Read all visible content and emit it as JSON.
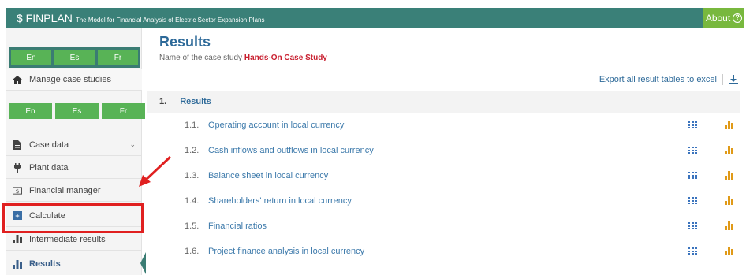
{
  "header": {
    "app_name": "$ FINPLAN",
    "tagline": "The Model for Financial Analysis of Electric Sector Expansion Plans",
    "about_label": "About",
    "about_icon": "?"
  },
  "sidebar": {
    "languages_top": [
      "En",
      "Es",
      "Fr"
    ],
    "manage_label": "Manage case studies",
    "languages_mid": [
      "En",
      "Es",
      "Fr"
    ],
    "items": [
      {
        "label": "Case data",
        "icon": "file-icon"
      },
      {
        "label": "Plant data",
        "icon": "plug-icon"
      },
      {
        "label": "Financial manager",
        "icon": "money-icon"
      },
      {
        "label": "Calculate",
        "icon": "calculator-icon"
      },
      {
        "label": "Intermediate results",
        "icon": "bar-chart-icon"
      },
      {
        "label": "Results",
        "icon": "bar-chart-icon"
      }
    ],
    "chevron": "⌄"
  },
  "main": {
    "title": "Results",
    "case_prefix": "Name of the case study",
    "case_name": "Hands-On Case Study",
    "export_label": "Export all result tables to excel",
    "section": {
      "num": "1.",
      "title": "Results"
    },
    "rows": [
      {
        "num": "1.1.",
        "label": "Operating account in local currency"
      },
      {
        "num": "1.2.",
        "label": "Cash inflows and outflows in local currency"
      },
      {
        "num": "1.3.",
        "label": "Balance sheet in local currency"
      },
      {
        "num": "1.4.",
        "label": "Shareholders' return in local currency"
      },
      {
        "num": "1.5.",
        "label": "Financial ratios"
      },
      {
        "num": "1.6.",
        "label": "Project finance analysis in local currency"
      }
    ]
  },
  "colors": {
    "topbar": "#3a8078",
    "about": "#78b83e",
    "lang_button": "#58b356",
    "title": "#2e6a99",
    "case_name": "#c81e2e",
    "highlight": "#e02020",
    "table_icon": "#3a73bd",
    "chart_icon": "#e09a18"
  }
}
